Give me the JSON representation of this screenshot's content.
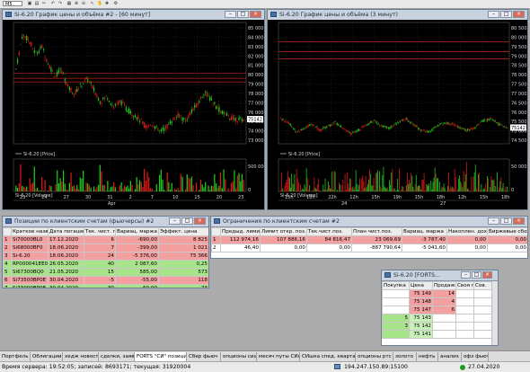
{
  "toolbar": {
    "combo": "M5",
    "icons": [
      "save-icon",
      "open-icon",
      "cut-icon",
      "undo-icon",
      "redo-icon",
      "hand-icon",
      "cursor-icon",
      "zoom-icon",
      "grid-icon",
      "settings-icon"
    ]
  },
  "chart60": {
    "title": "Si-6.20 График цены и объёма #2 - [60 минут]",
    "price_label": "Si-6.20 [Price]",
    "volume_label": "Si-6.20 [Volume]",
    "last_price": "75142",
    "y_ticks": [
      "85 000",
      "84 000",
      "83 000",
      "82 000",
      "81 000",
      "80 000",
      "79 000",
      "78 000",
      "77 000",
      "76 000",
      "75 000",
      "74 000",
      "73 000"
    ],
    "vol_ticks": [
      "500 000",
      "0"
    ],
    "x_ticks": [
      "23",
      "24",
      "27",
      "30",
      "31",
      "2",
      "7",
      "10",
      "15",
      "20",
      "23"
    ],
    "x_sub_label": "Apr",
    "chart_data": {
      "type": "line",
      "series": [
        {
          "values": [
            80500,
            84200,
            83600,
            82100,
            82900,
            81000,
            79800,
            80400,
            78600,
            77900,
            78800,
            79500,
            78200,
            77000,
            77600,
            76400,
            77100,
            76200,
            75700,
            75100,
            74300,
            74600,
            73800,
            74200,
            75000,
            75600,
            74900,
            76000,
            76800,
            78100,
            77200,
            76300,
            75700,
            75300,
            75100,
            75142
          ]
        }
      ],
      "ylim": [
        72500,
        85500
      ]
    }
  },
  "chart3": {
    "title": "Si-6.20 График цены и объёма (3 минут)",
    "price_label": "Si-6.20 [Price]",
    "volume_label": "Si-6.20 [Volume]",
    "last_price": "75142",
    "y_ticks": [
      "80 500",
      "80 000",
      "79 500",
      "79 000",
      "78 500",
      "78 000",
      "77 500",
      "77 000",
      "76 500",
      "76 000",
      "75 500",
      "75 000",
      "74 500"
    ],
    "vol_ticks": [
      "50 000",
      "0"
    ],
    "x_ticks": [
      "15h",
      "18h",
      "22h",
      "12h",
      "15h",
      "19h",
      "15h",
      "18h",
      "12h",
      "15h",
      "18h"
    ],
    "day_labels": [
      "24",
      "27"
    ],
    "chart_data": {
      "type": "line",
      "series": [
        {
          "values": [
            75600,
            75400,
            74900,
            75100,
            75300,
            75000,
            75200,
            75400,
            75100,
            74800,
            75000,
            75300,
            75500,
            75200,
            75100,
            75400,
            75600,
            75300,
            75000,
            74900,
            75200,
            75400,
            75300,
            75100,
            75000,
            75200,
            75500,
            75600,
            75300,
            75142
          ]
        }
      ],
      "ylim": [
        74300,
        80600
      ]
    }
  },
  "positions": {
    "title": "Позиции по клиентским счетам (фьючерсы) #2",
    "columns": [
      "",
      "Краткое название",
      "Дата погашения",
      "Тек. чист. поз.",
      "Вариац. маржа",
      "Эффект. цена"
    ],
    "rows": [
      [
        "1",
        "Si70000BL0",
        "17.12.2020",
        "6",
        "-690,00",
        "8 825"
      ],
      [
        "2",
        "Si68000BF0",
        "18.06.2020",
        "7",
        "-399,00",
        "1 021"
      ],
      [
        "3",
        "Si-6.20",
        "18.06.2020",
        "24",
        "-5 376,00",
        "75 366"
      ],
      [
        "4",
        "RP000041EE0",
        "26.05.2020",
        "40",
        "2 087,60",
        "0,25"
      ],
      [
        "5",
        "Si67300BQ0",
        "21.05.2020",
        "15",
        "585,00",
        "573"
      ],
      [
        "6",
        "Si73500BP0E",
        "30.04.2020",
        "-5",
        "-55,00",
        "118"
      ],
      [
        "7",
        "Si73000BP0E",
        "30.04.2020",
        "30",
        "60,00",
        "73"
      ]
    ],
    "row_colors": [
      "#f5a0a0",
      "#f5a0a0",
      "#f5a0a0",
      "#a8e58a",
      "#a8e58a",
      "#f5a0a0",
      "#a8e58a"
    ]
  },
  "limits": {
    "title": "Ограничения по клиентским счетам #2",
    "columns": [
      "",
      "Предыд. лимит",
      "Лимит откр. поз.",
      "Тек.чист.поз.",
      "План чист.поз.",
      "Вариац. маржа",
      "Накоплен. доход",
      "Биржевые сборы"
    ],
    "rows": [
      [
        "1",
        "112 974,16",
        "107 886,16",
        "84 816,47",
        "23 069,69",
        "-3 787,40",
        "0,00",
        "0,00"
      ],
      [
        "2",
        "46,40",
        "0,00",
        "0,00",
        "-887 790,64",
        "-5 041,60",
        "0,00",
        "0,00"
      ]
    ],
    "row_colors": [
      "#f5a0a0",
      "#ffffff"
    ]
  },
  "quotes": {
    "title": "Si-6.20 [FORTS...",
    "columns": [
      "Покупка",
      "Цена",
      "Продажа",
      "Своя п.",
      "Сов."
    ],
    "rows": [
      [
        "",
        "75 149",
        "14",
        "",
        ""
      ],
      [
        "",
        "75 148",
        "4",
        "",
        ""
      ],
      [
        "",
        "75 147",
        "6",
        "",
        ""
      ],
      [
        "5",
        "75 143",
        "",
        "",
        ""
      ],
      [
        "3",
        "75 142",
        "",
        "",
        ""
      ],
      [
        "",
        "75 141",
        "",
        "",
        ""
      ]
    ]
  },
  "tabs": [
    "Портфель",
    "Облигации",
    "хедж новости",
    "сделки, заявки",
    "FORTS \"СИ\" позиции",
    "Сбер фьюч",
    "опционы сишка",
    "месяч путы СИшка",
    "СИшка спед. квартал",
    "опционы ртс",
    "золото",
    "нефть",
    "анализ",
    "офз фьючи"
  ],
  "active_tab": 4,
  "status": {
    "left": "Время сервера: 19:52:05; записей: 8693171; текущая: 31920004",
    "connection": "194.247.150.89:15100",
    "date": "27.04.2020"
  }
}
